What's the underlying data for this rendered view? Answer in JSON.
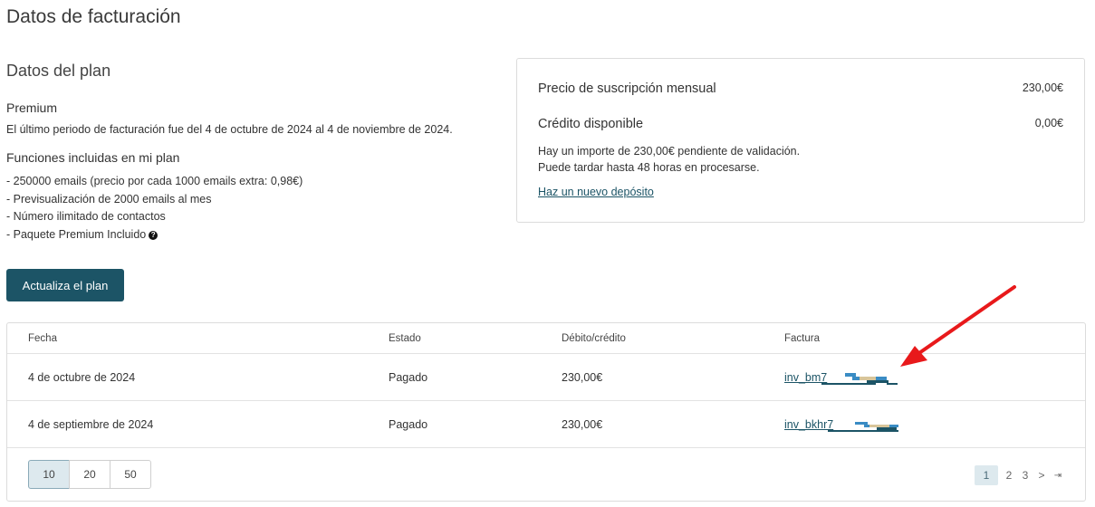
{
  "page": {
    "title": "Datos de facturación"
  },
  "plan": {
    "section_title": "Datos del plan",
    "name": "Premium",
    "period_text": "El último periodo de facturación fue del 4 de octubre de 2024 al 4 de noviembre de 2024.",
    "features_title": "Funciones incluidas en mi plan",
    "features": [
      "- 250000 emails (precio por cada 1000 emails extra: 0,98€)",
      "- Previsualización de 2000 emails al mes",
      "- Número ilimitado de contactos",
      "- Paquete Premium Incluido"
    ],
    "upgrade_label": "Actualiza el plan"
  },
  "summary": {
    "subscription_label": "Precio de suscripción mensual",
    "subscription_value": "230,00€",
    "credit_label": "Crédito disponible",
    "credit_value": "0,00€",
    "pending_line1": "Hay un importe de 230,00€ pendiente de validación.",
    "pending_line2": "Puede tardar hasta 48 horas en procesarse.",
    "deposit_link": "Haz un nuevo depósito"
  },
  "table": {
    "headers": {
      "date": "Fecha",
      "status": "Estado",
      "amount": "Débito/crédito",
      "invoice": "Factura"
    },
    "rows": [
      {
        "date": "4 de octubre de 2024",
        "status": "Pagado",
        "amount": "230,00€",
        "invoice": "inv_bm7"
      },
      {
        "date": "4 de septiembre de 2024",
        "status": "Pagado",
        "amount": "230,00€",
        "invoice": "inv_bkhr7"
      }
    ]
  },
  "pagination": {
    "page_sizes": [
      "10",
      "20",
      "50"
    ],
    "selected_page_size": "10",
    "pages": [
      "1",
      "2",
      "3"
    ],
    "current_page": "1",
    "next": ">",
    "last": "⇥"
  },
  "colors": {
    "primary": "#1c5466",
    "annotation_arrow": "#e8191b",
    "redaction_blue": "#3a8cc4",
    "redaction_dark": "#1c5466",
    "redaction_tan": "#d8c59a"
  },
  "icons": {
    "help": "question-circle-icon",
    "annotation": "red-arrow-annotation"
  }
}
